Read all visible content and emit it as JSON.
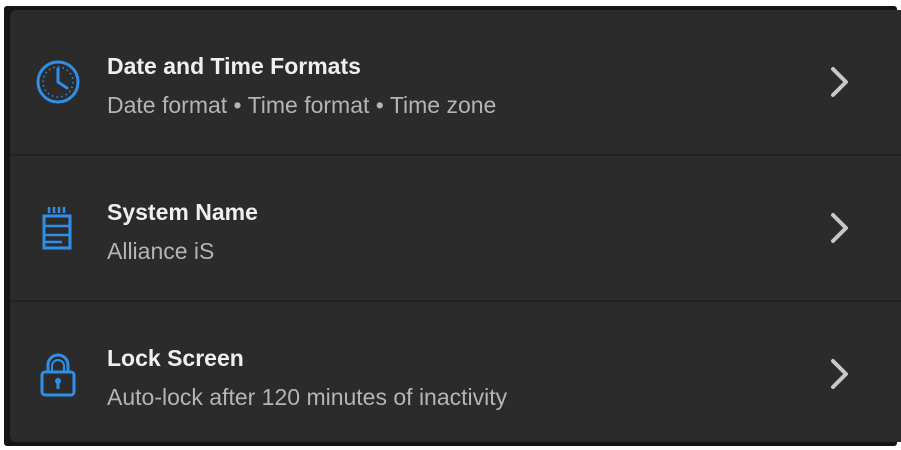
{
  "colors": {
    "accent_icon": "#2f8fe8",
    "row_background": "#2b2b2b",
    "title_text": "#efefef",
    "subtitle_text": "#b4b4b4",
    "chevron": "#c8c8c8"
  },
  "settings": {
    "items": [
      {
        "icon": "clock-icon",
        "title": "Date and Time Formats",
        "subtitle": "Date format • Time format • Time zone"
      },
      {
        "icon": "device-icon",
        "title": "System Name",
        "subtitle": "Alliance iS"
      },
      {
        "icon": "lock-icon",
        "title": "Lock Screen",
        "subtitle": "Auto-lock after 120 minutes of inactivity"
      }
    ]
  }
}
